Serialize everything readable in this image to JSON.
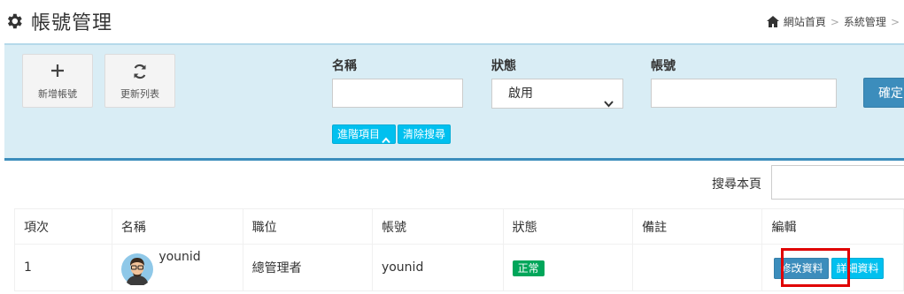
{
  "header": {
    "title": "帳號管理",
    "breadcrumb": [
      "網站首頁",
      "系統管理"
    ],
    "breadcrumb_sep": ">"
  },
  "toolbar": {
    "add_label": "新增帳號",
    "refresh_label": "更新列表"
  },
  "search": {
    "name_label": "名稱",
    "name_value": "",
    "status_label": "狀態",
    "status_selected": "啟用",
    "account_label": "帳號",
    "account_value": "",
    "confirm_label": "確定",
    "advanced_label": "進階項目",
    "clear_label": "清除搜尋"
  },
  "page_search": {
    "label": "搜尋本頁",
    "value": ""
  },
  "table": {
    "headers": [
      "項次",
      "名稱",
      "職位",
      "帳號",
      "狀態",
      "備註",
      "編輯"
    ],
    "rows": [
      {
        "index": "1",
        "name": "younid",
        "position": "總管理者",
        "account": "younid",
        "status": "正常",
        "note": "",
        "edit_label": "修改資料",
        "detail_label": "詳細資料"
      }
    ]
  },
  "colors": {
    "panel_bg": "#d9edf5",
    "primary": "#3c8dbc",
    "info": "#00c0ef",
    "success": "#00a65a",
    "highlight": "#e00000"
  }
}
